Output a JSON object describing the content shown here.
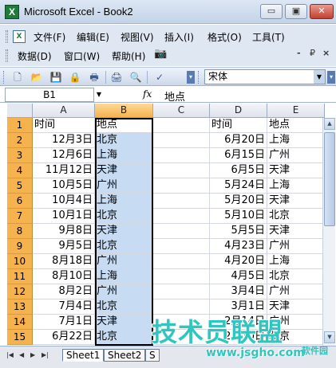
{
  "window": {
    "title": "Microsoft Excel - Book2",
    "min": "▭",
    "max": "▣",
    "close": "✕"
  },
  "menu": {
    "row1": [
      "文件(F)",
      "编辑(E)",
      "视图(V)",
      "插入(I)",
      "格式(O)",
      "工具(T)"
    ],
    "row2": [
      "数据(D)",
      "窗口(W)",
      "帮助(H)"
    ],
    "mdi": [
      "-",
      "₽",
      "×"
    ]
  },
  "toolbar": {
    "font": "宋体"
  },
  "formula": {
    "cell_ref": "B1",
    "fx": "fx",
    "content": "地点"
  },
  "columns": [
    "A",
    "B",
    "C",
    "D",
    "E"
  ],
  "rows": [
    {
      "n": "1",
      "A": "时间",
      "B": "地点",
      "D": "时间",
      "E": "地点"
    },
    {
      "n": "2",
      "A": "12月3日",
      "B": "北京",
      "D": "6月20日",
      "E": "上海"
    },
    {
      "n": "3",
      "A": "12月6日",
      "B": "上海",
      "D": "6月15日",
      "E": "广州"
    },
    {
      "n": "4",
      "A": "11月12日",
      "B": "天津",
      "D": "6月5日",
      "E": "天津"
    },
    {
      "n": "5",
      "A": "10月5日",
      "B": "广州",
      "D": "5月24日",
      "E": "上海"
    },
    {
      "n": "6",
      "A": "10月4日",
      "B": "上海",
      "D": "5月20日",
      "E": "天津"
    },
    {
      "n": "7",
      "A": "10月1日",
      "B": "北京",
      "D": "5月10日",
      "E": "北京"
    },
    {
      "n": "8",
      "A": "9月8日",
      "B": "天津",
      "D": "5月5日",
      "E": "天津"
    },
    {
      "n": "9",
      "A": "9月5日",
      "B": "北京",
      "D": "4月23日",
      "E": "广州"
    },
    {
      "n": "10",
      "A": "8月18日",
      "B": "广州",
      "D": "4月20日",
      "E": "上海"
    },
    {
      "n": "11",
      "A": "8月10日",
      "B": "上海",
      "D": "4月5日",
      "E": "北京"
    },
    {
      "n": "12",
      "A": "8月2日",
      "B": "广州",
      "D": "3月4日",
      "E": "广州"
    },
    {
      "n": "13",
      "A": "7月4日",
      "B": "北京",
      "D": "3月1日",
      "E": "天津"
    },
    {
      "n": "14",
      "A": "7月1日",
      "B": "天津",
      "D": "2月14日",
      "E": "广州"
    },
    {
      "n": "15",
      "A": "6月22日",
      "B": "北京",
      "D": "2月10日",
      "E": "北京"
    }
  ],
  "sheets": [
    "Sheet1",
    "Sheet2",
    "S"
  ],
  "watermark": {
    "main": "技术员联盟",
    "url": "www.jsgho.com",
    "side": "软件园"
  }
}
